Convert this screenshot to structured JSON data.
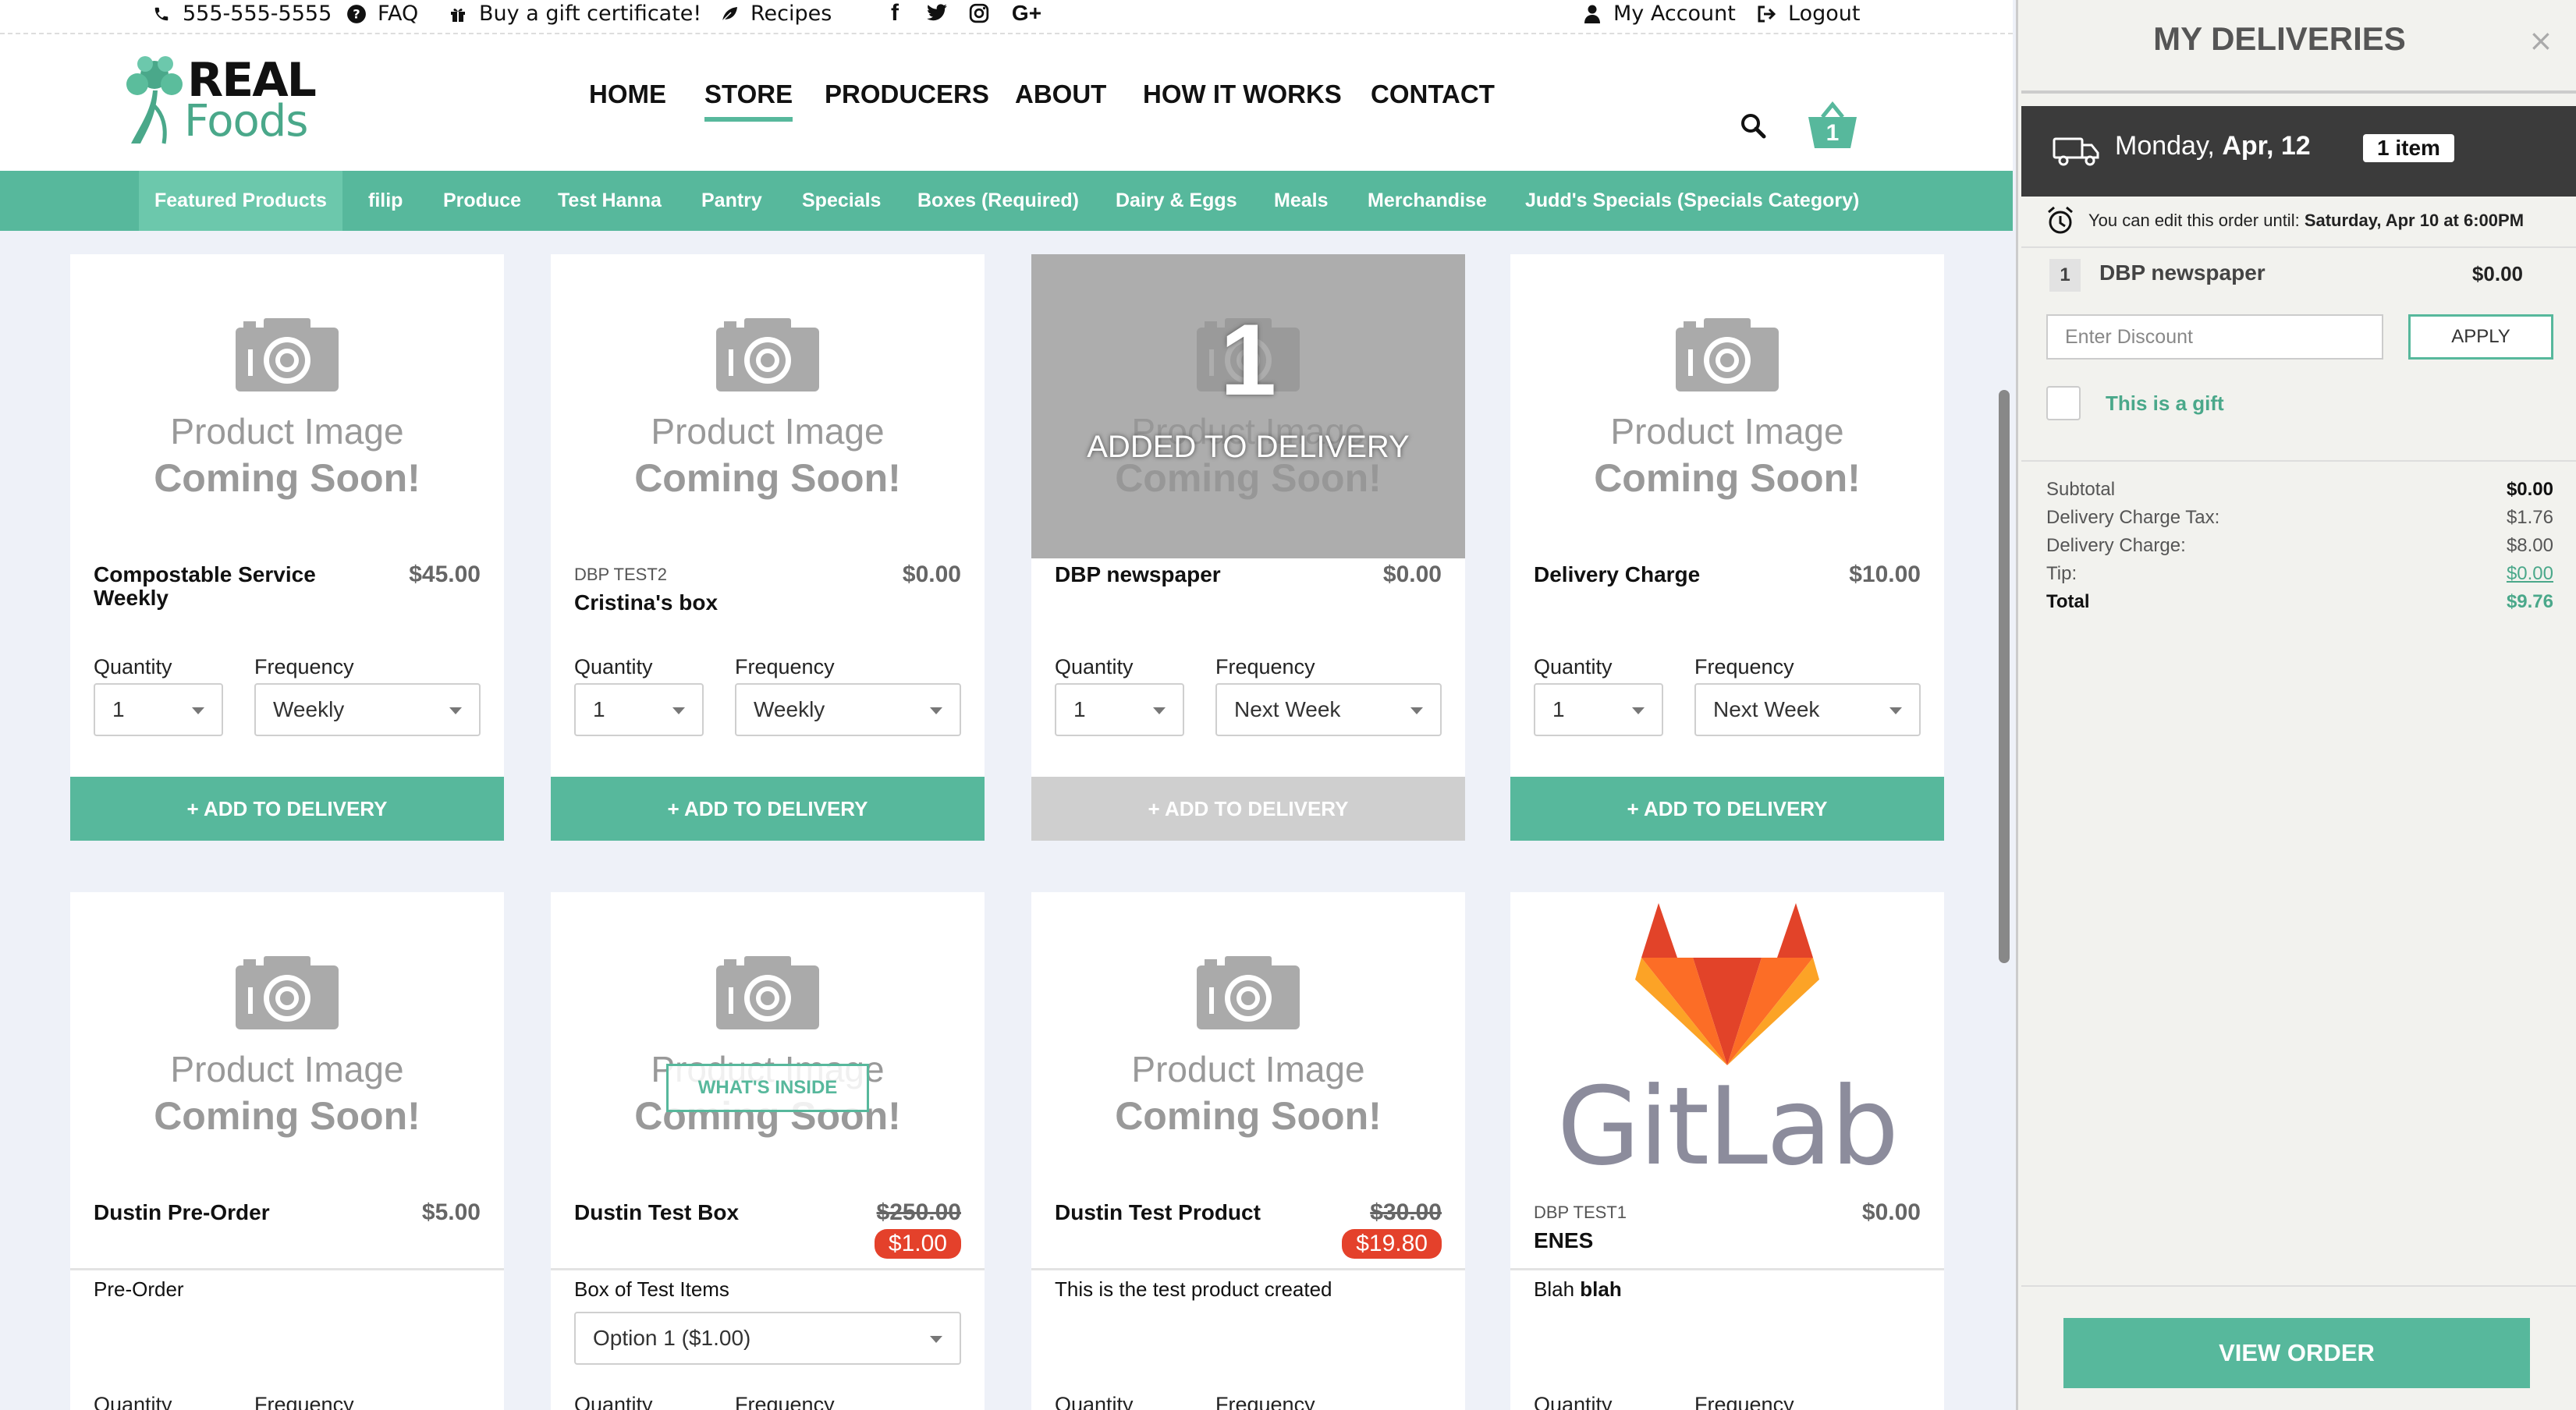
{
  "topbar": {
    "phone": "555-555-5555",
    "faq": "FAQ",
    "gift": "Buy a gift certificate!",
    "recipes": "Recipes",
    "account": "My Account",
    "logout": "Logout"
  },
  "logo": {
    "line1": "REAL",
    "line2": "Foods"
  },
  "nav": {
    "home": "HOME",
    "store": "STORE",
    "producers": "PRODUCERS",
    "about": "ABOUT",
    "how": "HOW IT WORKS",
    "contact": "CONTACT"
  },
  "cart_count": "1",
  "categories": [
    "Featured Products",
    "filip",
    "Produce",
    "Test Hanna",
    "Pantry",
    "Specials",
    "Boxes (Required)",
    "Dairy & Eggs",
    "Meals",
    "Merchandise",
    "Judd's Specials (Specials Category)"
  ],
  "placeholder": {
    "line1": "Product Image",
    "line2": "Coming Soon!"
  },
  "labels": {
    "quantity": "Quantity",
    "frequency": "Frequency",
    "add": "+ ADD TO DELIVERY",
    "added": "ADDED TO DELIVERY",
    "whats_inside": "WHAT'S INSIDE"
  },
  "products": [
    {
      "name": "Compostable Service Weekly",
      "producer": "",
      "price": "$45.00",
      "qty": "1",
      "freq": "Weekly"
    },
    {
      "name": "Cristina's box",
      "producer": "DBP TEST2",
      "price": "$0.00",
      "qty": "1",
      "freq": "Weekly"
    },
    {
      "name": "DBP newspaper",
      "producer": "",
      "price": "$0.00",
      "qty": "1",
      "freq": "Next Week",
      "in_cart": "1"
    },
    {
      "name": "Delivery Charge",
      "producer": "",
      "price": "$10.00",
      "qty": "1",
      "freq": "Next Week"
    },
    {
      "name": "Dustin Pre-Order",
      "producer": "",
      "price": "$5.00",
      "desc": "Pre-Order"
    },
    {
      "name": "Dustin Test Box",
      "producer": "",
      "old_price": "$250.00",
      "price": "$1.00",
      "desc": "Box of Test Items",
      "option": "Option 1 ($1.00)"
    },
    {
      "name": "Dustin Test Product",
      "producer": "",
      "old_price": "$30.00",
      "price": "$19.80",
      "desc": "This is the test product created"
    },
    {
      "name": "ENES",
      "producer": "DBP TEST1",
      "price": "$0.00",
      "desc_pre": "Blah ",
      "desc_bold": "blah",
      "image_word": "GitLab"
    }
  ],
  "panel": {
    "title": "MY DELIVERIES",
    "close": "×",
    "date_prefix": "Monday, ",
    "date_bold": "Apr, 12",
    "items_badge": "1 item",
    "edit_note": "You can edit this order until: ",
    "edit_deadline": "Saturday, Apr 10 at 6:00PM",
    "line_qty": "1",
    "line_name": "DBP newspaper",
    "line_price": "$0.00",
    "discount_placeholder": "Enter Discount",
    "apply": "APPLY",
    "gift": "This is a gift",
    "summary": [
      {
        "label": "Subtotal",
        "value": "$0.00"
      },
      {
        "label": "Delivery Charge Tax:",
        "value": "$1.76"
      },
      {
        "label": "Delivery Charge:",
        "value": "$8.00"
      },
      {
        "label": "Tip:",
        "value": "$0.00"
      },
      {
        "label": "Total",
        "value": "$9.76"
      }
    ],
    "view_order": "VIEW ORDER"
  },
  "colors": {
    "accent": "#57b89c",
    "sale": "#e4412b",
    "panel_dark": "#3b3b3b"
  },
  "icons": [
    "phone-icon",
    "question-icon",
    "gift-icon",
    "leaf-icon",
    "facebook-icon",
    "twitter-icon",
    "instagram-icon",
    "google-plus-icon",
    "user-icon",
    "logout-icon",
    "search-icon",
    "basket-icon",
    "truck-icon",
    "alarm-clock-icon",
    "camera-icon",
    "close-icon"
  ]
}
